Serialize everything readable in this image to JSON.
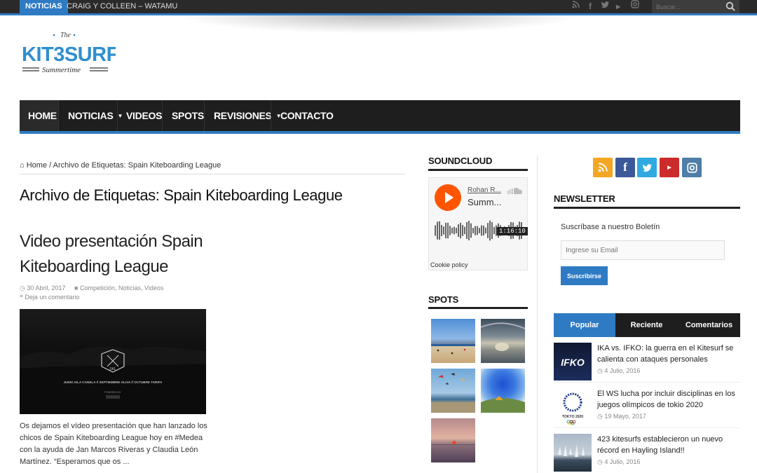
{
  "topbar": {
    "tag": "NOTICIAS",
    "ticker": "CRAIG Y COLLEEN – WATAMU",
    "search_placeholder": "Buscar..."
  },
  "logo": {
    "the": "The",
    "name": "KIT3SURF",
    "tagline": "Summertime"
  },
  "nav": {
    "items": [
      {
        "label": "HOME"
      },
      {
        "label": "NOTICIAS"
      },
      {
        "label": "VIDEOS"
      },
      {
        "label": "SPOTS"
      },
      {
        "label": "REVISIONES"
      },
      {
        "label": "CONTACTO"
      }
    ]
  },
  "breadcrumb": {
    "home": "Home",
    "sep": "/",
    "current": "Archivo de Etiquetas: Spain Kiteboarding League"
  },
  "page_title": "Archivo de Etiquetas: Spain Kiteboarding League",
  "post": {
    "title_line1": "Video presentación Spain",
    "title_line2": "Kiteboarding League",
    "date": "30 Abril, 2017",
    "categories": "Competición, Noticias, Videos",
    "comment": "Deja un comentario",
    "image_text": "JUNIO ISLA CANELA  //  SEPTIEMBRE OLIVA  //  OCTUBRE TARIFA",
    "image_logo": "SKL",
    "image_powered": "POWERED BY",
    "excerpt": "Os dejamos el vídeo presentación que han lanzado los chicos de Spain Kiteboarding League hoy en #Medea con la ayuda de Jan Marcos Riveras y Claudia León Martínez. “Esperamos que os ..."
  },
  "soundcloud": {
    "title": "SOUNDCLOUD",
    "user": "Rohan R...",
    "track": "Summ...",
    "time": "1:16:10",
    "cookie": "Cookie policy"
  },
  "spots": {
    "title": "SPOTS"
  },
  "newsletter": {
    "title": "NEWSLETTER",
    "text": "Suscríbase a nuestro Boletín",
    "placeholder": "Ingrese su Email",
    "button": "Suscribirse"
  },
  "tabs": [
    {
      "label": "Popular"
    },
    {
      "label": "Reciente"
    },
    {
      "label": "Comentarios"
    }
  ],
  "popular": [
    {
      "title": "IKA vs. IFKO: la guerra en el Kitesurf se calienta con ataques personales",
      "date": "4 Julio, 2016",
      "thumb_text": "IFKO"
    },
    {
      "title": "El WS lucha por incluir disciplinas en los juegos olímpicos de tokio 2020",
      "date": "19 Mayo, 2017",
      "thumb_text": "TOKYO 2020"
    },
    {
      "title": "423 kitesurfs establecieron un nuevo récord en Hayling Island!!",
      "date": "4 Julio, 2016",
      "thumb_text": ""
    }
  ],
  "colors": {
    "accent": "#2e7bc4",
    "dark": "#1e1e1e",
    "rss": "#f5a623",
    "facebook": "#3b5998",
    "twitter": "#2fa9e0",
    "youtube": "#cc2b2b",
    "instagram": "#4f7ea8"
  }
}
